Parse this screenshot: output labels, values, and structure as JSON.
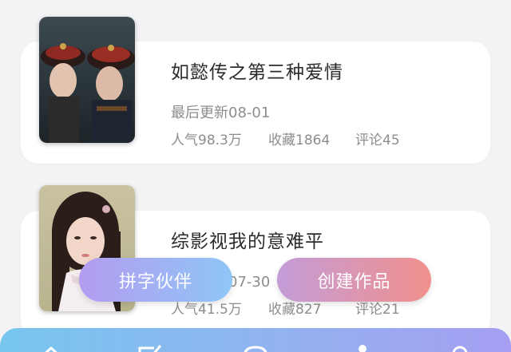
{
  "works": [
    {
      "title": "如懿传之第三种爱情",
      "last_updated": "最后更新08-01",
      "popularity": "人气98.3万",
      "favorites": "收藏1864",
      "comments": "评论45"
    },
    {
      "title": "综影视我的意难平",
      "last_updated": "最后更新07-30",
      "popularity": "人气41.5万",
      "favorites": "收藏827",
      "comments": "评论21"
    }
  ],
  "actions": {
    "partner_label": "拼字伙伴",
    "create_label": "创建作品"
  },
  "bottom_nav": {
    "icons": [
      "home-icon",
      "edit-icon",
      "chat-icon",
      "profile-icon",
      "search-icon"
    ]
  },
  "colors": {
    "page_background": "#f3f3f5",
    "card_background": "#ffffff",
    "title_text": "#2b2b2b",
    "meta_text": "#8d8d8d",
    "partner_gradient_start": "#b39cf0",
    "partner_gradient_end": "#8fc6f6",
    "create_gradient_start": "#c39cd8",
    "create_gradient_end": "#f1908c",
    "nav_gradient_start": "#76c6ee",
    "nav_gradient_end": "#a59ef1"
  }
}
